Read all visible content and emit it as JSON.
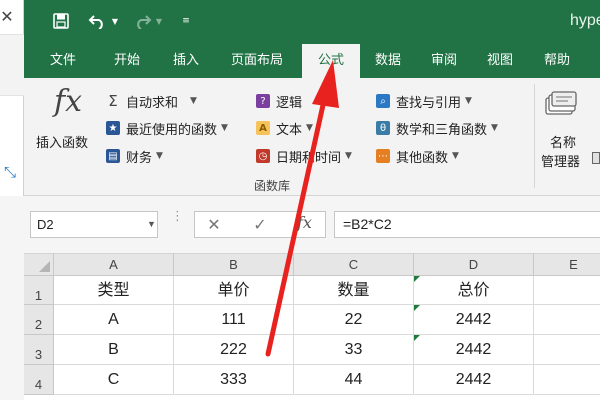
{
  "title": "hype",
  "menu": {
    "tabs": [
      {
        "label": "文件"
      },
      {
        "label": "开始"
      },
      {
        "label": "插入"
      },
      {
        "label": "页面布局"
      },
      {
        "label": "公式",
        "active": true
      },
      {
        "label": "数据"
      },
      {
        "label": "审阅"
      },
      {
        "label": "视图"
      },
      {
        "label": "帮助"
      }
    ]
  },
  "ribbon": {
    "insert_function": "插入函数",
    "col1": [
      {
        "label": "自动求和",
        "icon": "sigma-icon",
        "color": "#444444"
      },
      {
        "label": "最近使用的函数",
        "icon": "star-icon",
        "color": "#2b5797"
      },
      {
        "label": "财务",
        "icon": "finance-book-icon",
        "color": "#2b5797"
      }
    ],
    "col2": [
      {
        "label": "逻辑",
        "icon": "question-icon",
        "color": "#7b3fa0"
      },
      {
        "label": "文本",
        "icon": "text-a-icon",
        "color": "#f0a030"
      },
      {
        "label": "日期和时间",
        "icon": "clock-icon",
        "color": "#c0392b"
      }
    ],
    "col3": [
      {
        "label": "查找与引用",
        "icon": "lookup-icon",
        "color": "#2b78c5"
      },
      {
        "label": "数学和三角函数",
        "icon": "theta-icon",
        "color": "#3a7ca5"
      },
      {
        "label": "其他函数",
        "icon": "more-functions-icon",
        "color": "#e67e22"
      }
    ],
    "group_label": "函数库",
    "name_manager": [
      "名称",
      "管理器"
    ]
  },
  "formula_bar": {
    "name_box": "D2",
    "formula": "=B2*C2"
  },
  "sheet": {
    "columns": [
      "A",
      "B",
      "C",
      "D",
      "E"
    ],
    "rows": [
      {
        "num": "1",
        "cells": [
          "类型",
          "单价",
          "数量",
          "总价"
        ]
      },
      {
        "num": "2",
        "cells": [
          "A",
          "111",
          "22",
          "2442"
        ]
      },
      {
        "num": "3",
        "cells": [
          "B",
          "222",
          "33",
          "2442"
        ]
      },
      {
        "num": "4",
        "cells": [
          "C",
          "333",
          "44",
          "2442"
        ]
      }
    ]
  },
  "colors": {
    "excel_green": "#217346",
    "arrow_red": "#e8231f"
  }
}
